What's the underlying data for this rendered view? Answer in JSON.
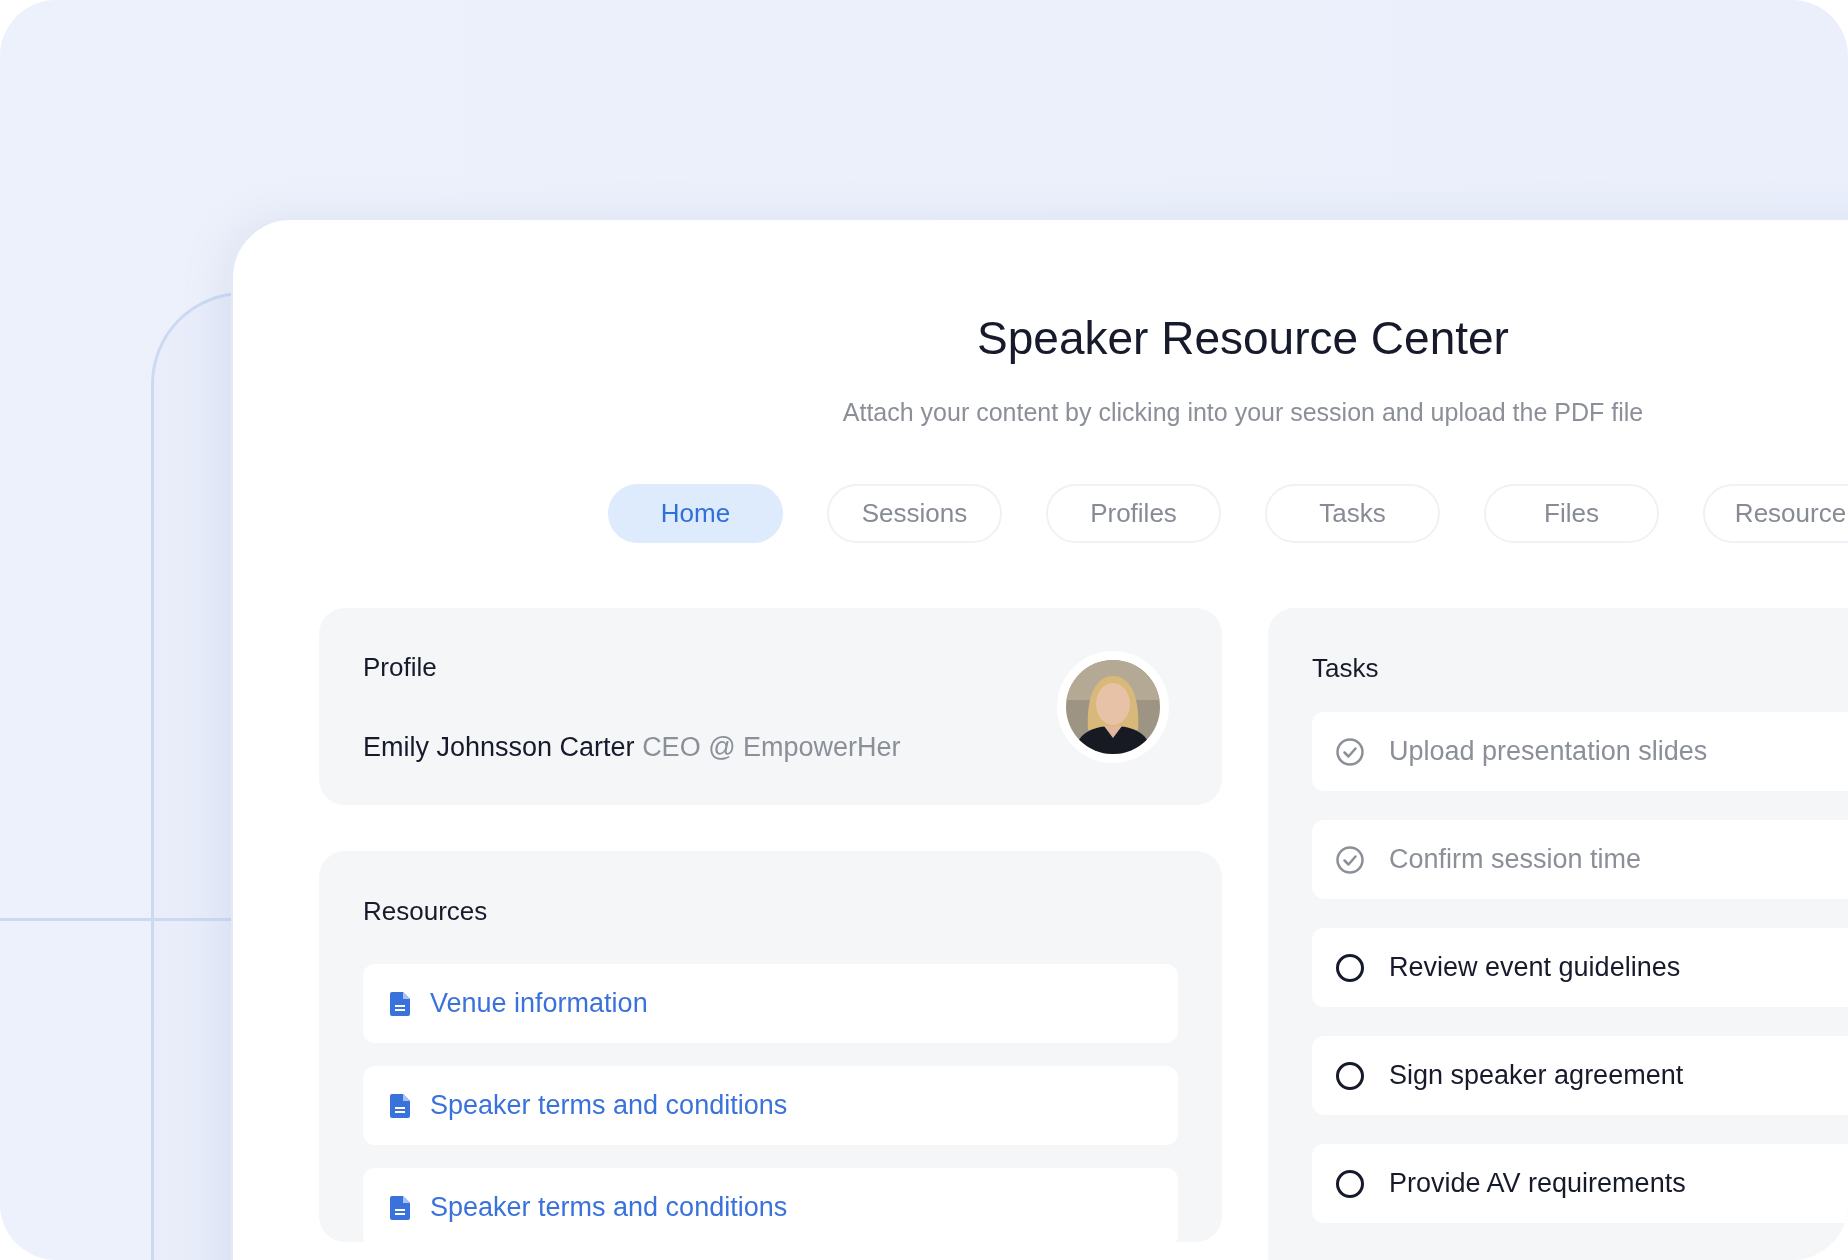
{
  "header": {
    "title": "Speaker Resource Center",
    "subtitle": "Attach your content by clicking into your session and upload the PDF file"
  },
  "tabs": [
    {
      "label": "Home",
      "selected": true
    },
    {
      "label": "Sessions",
      "selected": false
    },
    {
      "label": "Profiles",
      "selected": false
    },
    {
      "label": "Tasks",
      "selected": false
    },
    {
      "label": "Files",
      "selected": false
    },
    {
      "label": "Resource",
      "selected": false
    }
  ],
  "profile": {
    "heading": "Profile",
    "name": "Emily Johnsson Carter",
    "role": "CEO @ EmpowerHer"
  },
  "resources": {
    "heading": "Resources",
    "items": [
      {
        "label": "Venue information"
      },
      {
        "label": "Speaker terms and conditions"
      },
      {
        "label": "Speaker terms and conditions"
      }
    ]
  },
  "tasks": {
    "heading": "Tasks",
    "items": [
      {
        "label": "Upload presentation slides",
        "done": true
      },
      {
        "label": "Confirm session time",
        "done": true
      },
      {
        "label": "Review event guidelines",
        "done": false
      },
      {
        "label": "Sign speaker agreement",
        "done": false
      },
      {
        "label": "Provide AV requirements",
        "done": false
      }
    ]
  }
}
